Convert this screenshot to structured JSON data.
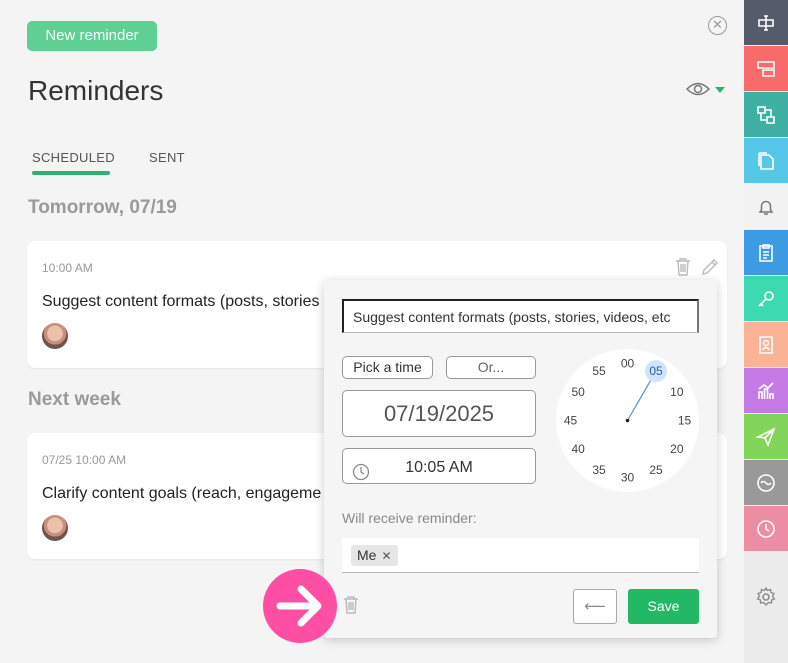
{
  "header": {
    "new_reminder_label": "New reminder",
    "close_icon": "close-circle-icon",
    "title": "Reminders"
  },
  "tabs": [
    {
      "label": "SCHEDULED"
    },
    {
      "label": "SENT"
    }
  ],
  "sections": [
    {
      "title": "Tomorrow, 07/19",
      "card": {
        "time": "10:00 AM",
        "text": "Suggest content formats (posts, stories"
      }
    },
    {
      "title": "Next week",
      "card": {
        "time": "07/25 10:00 AM",
        "text": "Clarify content goals (reach, engageme"
      }
    }
  ],
  "popup": {
    "text_value": "Suggest content formats (posts, stories, videos, etc",
    "pick_time_label": "Pick a time",
    "or_label": "Or...",
    "date_value": "07/19/2025",
    "time_value": "10:05 AM",
    "clock_numbers": [
      "00",
      "05",
      "10",
      "15",
      "20",
      "25",
      "30",
      "35",
      "40",
      "45",
      "50",
      "55"
    ],
    "selected_minute": "05",
    "recipients_label": "Will receive reminder:",
    "recipient_chip": "Me",
    "chip_remove": "✕",
    "back_label": "⟵",
    "save_label": "Save"
  },
  "colors": {
    "accent": "#22b866",
    "new_button": "#5fcf94",
    "highlight_arrow": "#ff4fa5"
  },
  "sidebar": [
    {
      "name": "text-field-icon",
      "color": "#555b6b"
    },
    {
      "name": "form-icon",
      "color": "#f96b6b"
    },
    {
      "name": "link-blocks-icon",
      "color": "#3fb0a3"
    },
    {
      "name": "copy-icon",
      "color": "#57c7e9"
    },
    {
      "name": "bell-icon",
      "color": "#f2f2f2"
    },
    {
      "name": "clipboard-icon",
      "color": "#3d9be3"
    },
    {
      "name": "key-icon",
      "color": "#3dd9b0"
    },
    {
      "name": "contact-icon",
      "color": "#fbb295"
    },
    {
      "name": "chart-icon",
      "color": "#c47be5"
    },
    {
      "name": "send-icon",
      "color": "#82d55a"
    },
    {
      "name": "wave-icon",
      "color": "#999999"
    },
    {
      "name": "history-clock-icon",
      "color": "#ec8da4"
    },
    {
      "name": "settings-icon",
      "color": "#ececec"
    }
  ]
}
